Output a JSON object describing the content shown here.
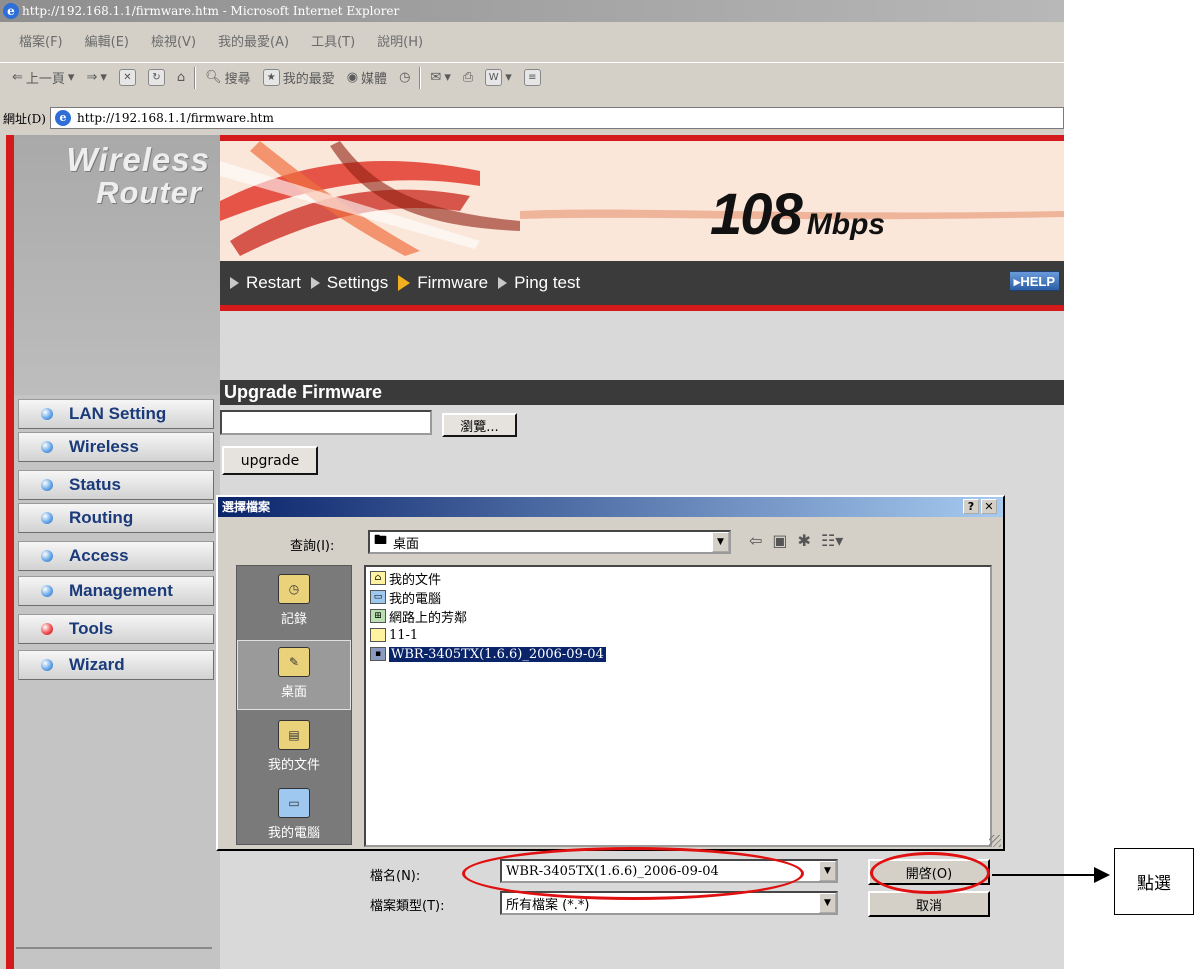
{
  "window": {
    "title": "http://192.168.1.1/firmware.htm - Microsoft Internet Explorer",
    "menu": [
      "檔案(F)",
      "編輯(E)",
      "檢視(V)",
      "我的最愛(A)",
      "工具(T)",
      "說明(H)"
    ],
    "toolbar": {
      "back": "上一頁",
      "search": "搜尋",
      "favorites": "我的最愛",
      "media": "媒體"
    },
    "address_label": "網址(D)",
    "address": "http://192.168.1.1/firmware.htm"
  },
  "router": {
    "logo_line1": "Wireless",
    "logo_line2": "Router",
    "speed": "108",
    "speed_unit": "Mbps",
    "tabs": [
      "Restart",
      "Settings",
      "Firmware",
      "Ping test"
    ],
    "active_tab": "Firmware",
    "help": "HELP",
    "nav": [
      "LAN Setting",
      "Wireless",
      "Status",
      "Routing",
      "Access",
      "Management",
      "Tools",
      "Wizard"
    ],
    "active_nav": "Tools",
    "section_title": "Upgrade Firmware",
    "browse_label": "瀏覽...",
    "upgrade_label": "upgrade"
  },
  "dialog": {
    "title": "選擇檔案",
    "look_in_label": "查詢(I):",
    "look_in_value": "桌面",
    "places": [
      "記錄",
      "桌面",
      "我的文件",
      "我的電腦",
      "網路上的芳鄰"
    ],
    "selected_place": "桌面",
    "files": [
      "我的文件",
      "我的電腦",
      "網路上的芳鄰",
      "11-1",
      "WBR-3405TX(1.6.6)_2006-09-04"
    ],
    "selected_file": "WBR-3405TX(1.6.6)_2006-09-04",
    "filename_label": "檔名(N):",
    "filename_value": "WBR-3405TX(1.6.6)_2006-09-04",
    "filetype_label": "檔案類型(T):",
    "filetype_value": "所有檔案 (*.*)",
    "open_label": "開啓(O)",
    "cancel_label": "取消"
  },
  "annotation": {
    "callout_text": "點選",
    "color": "#e01010"
  }
}
